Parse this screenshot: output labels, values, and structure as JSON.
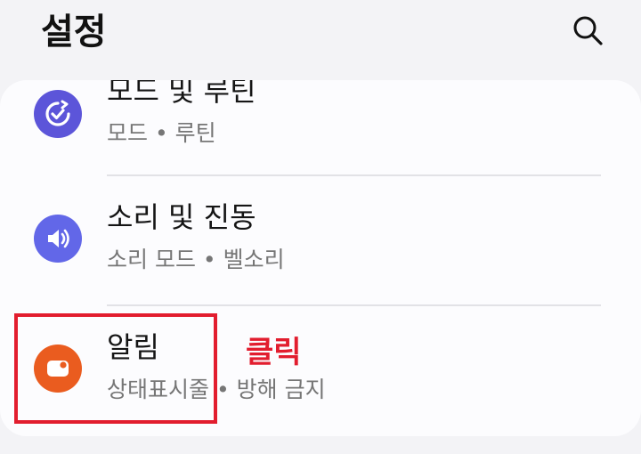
{
  "header": {
    "title": "설정"
  },
  "settings": {
    "items": [
      {
        "title": "모드 및 루틴",
        "subtitle": "모드 • 루틴",
        "icon": "modes-routines-icon",
        "color": "#5c55d9"
      },
      {
        "title": "소리 및 진동",
        "subtitle": "소리 모드 • 벨소리",
        "icon": "speaker-icon",
        "color": "#6267e8"
      },
      {
        "title": "알림",
        "subtitle": "상태표시줄 • 방해 금지",
        "icon": "notification-icon",
        "color": "#ea5c1f"
      }
    ]
  },
  "annotation": {
    "label": "클릭",
    "color": "#e21d2e"
  }
}
